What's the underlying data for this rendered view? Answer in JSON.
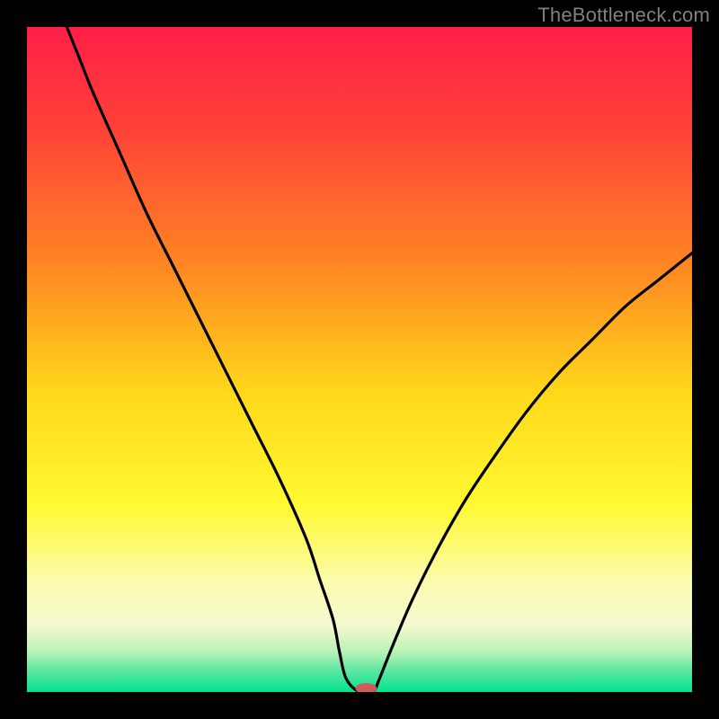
{
  "watermark": "TheBottleneck.com",
  "chart_data": {
    "type": "line",
    "title": "",
    "xlabel": "",
    "ylabel": "",
    "xlim": [
      0,
      100
    ],
    "ylim": [
      0,
      100
    ],
    "background_gradient": {
      "stops": [
        {
          "offset": 0.0,
          "color": "#ff1f48"
        },
        {
          "offset": 0.15,
          "color": "#ff4138"
        },
        {
          "offset": 0.35,
          "color": "#ff8324"
        },
        {
          "offset": 0.55,
          "color": "#ffd81a"
        },
        {
          "offset": 0.72,
          "color": "#fffa32"
        },
        {
          "offset": 0.84,
          "color": "#fbfbb3"
        },
        {
          "offset": 0.9,
          "color": "#f4f9ce"
        },
        {
          "offset": 0.94,
          "color": "#b7f2b7"
        },
        {
          "offset": 0.97,
          "color": "#57e6a0"
        },
        {
          "offset": 1.0,
          "color": "#00e38d"
        }
      ]
    },
    "series": [
      {
        "name": "bottleneck-curve",
        "x": [
          6,
          8,
          10,
          14,
          18,
          22,
          26,
          30,
          34,
          38,
          42,
          44,
          46,
          47,
          48,
          50,
          52,
          53,
          55,
          58,
          62,
          66,
          70,
          75,
          80,
          85,
          90,
          95,
          100
        ],
        "y": [
          100,
          95,
          90,
          81,
          72,
          64,
          56,
          48,
          40,
          32,
          23,
          17,
          11,
          6,
          2,
          0,
          0,
          2,
          7,
          14,
          22,
          29,
          35,
          42,
          48,
          53,
          58,
          62,
          66
        ]
      }
    ],
    "marker": {
      "name": "optimal-point",
      "x": 51,
      "y": 0,
      "color": "#d15a5a",
      "rx": 12,
      "ry": 6
    }
  }
}
